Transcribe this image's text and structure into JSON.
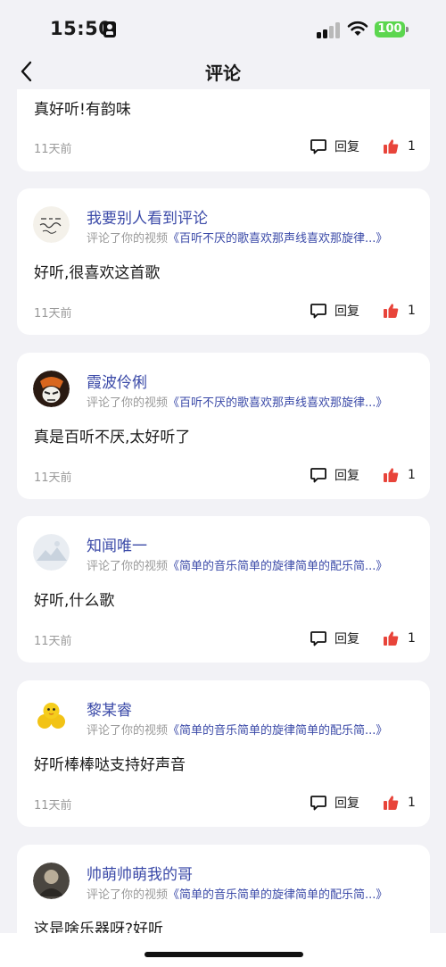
{
  "status_bar": {
    "time": "15:50",
    "battery": "100",
    "icons": [
      "id-card-icon",
      "signal-icon",
      "wifi-icon",
      "battery-icon"
    ]
  },
  "nav": {
    "title": "评论",
    "back_icon": "chevron-left-icon"
  },
  "common": {
    "reply_label": "回复",
    "reply_icon": "comment-bubble-icon",
    "like_icon": "thumbs-up-icon",
    "like_color": "#e8443a",
    "link_color": "#3b4aa8"
  },
  "comments": [
    {
      "user": "",
      "action": "",
      "video_title": "",
      "text": "真好听!有韵味",
      "time": "11天前",
      "likes": "1"
    },
    {
      "user": "我要别人看到评论",
      "action": "评论了你的视频",
      "video_title": "《百听不厌的歌喜欢那声线喜欢那旋律...》",
      "text": "好听,很喜欢这首歌",
      "time": "11天前",
      "likes": "1"
    },
    {
      "user": "霞波伶俐",
      "action": "评论了你的视频",
      "video_title": "《百听不厌的歌喜欢那声线喜欢那旋律...》",
      "text": "真是百听不厌,太好听了",
      "time": "11天前",
      "likes": "1"
    },
    {
      "user": "知闻唯一",
      "action": "评论了你的视频",
      "video_title": "《简单的音乐简单的旋律简单的配乐简...》",
      "text": "好听,什么歌",
      "time": "11天前",
      "likes": "1"
    },
    {
      "user": "黎某睿",
      "action": "评论了你的视频",
      "video_title": "《简单的音乐简单的旋律简单的配乐简...》",
      "text": "好听棒棒哒支持好声音",
      "time": "11天前",
      "likes": "1"
    },
    {
      "user": "帅萌帅萌我的哥",
      "action": "评论了你的视频",
      "video_title": "《简单的音乐简单的旋律简单的配乐简...》",
      "text": "这是啥乐器呀?好听",
      "time": "",
      "likes": ""
    }
  ]
}
